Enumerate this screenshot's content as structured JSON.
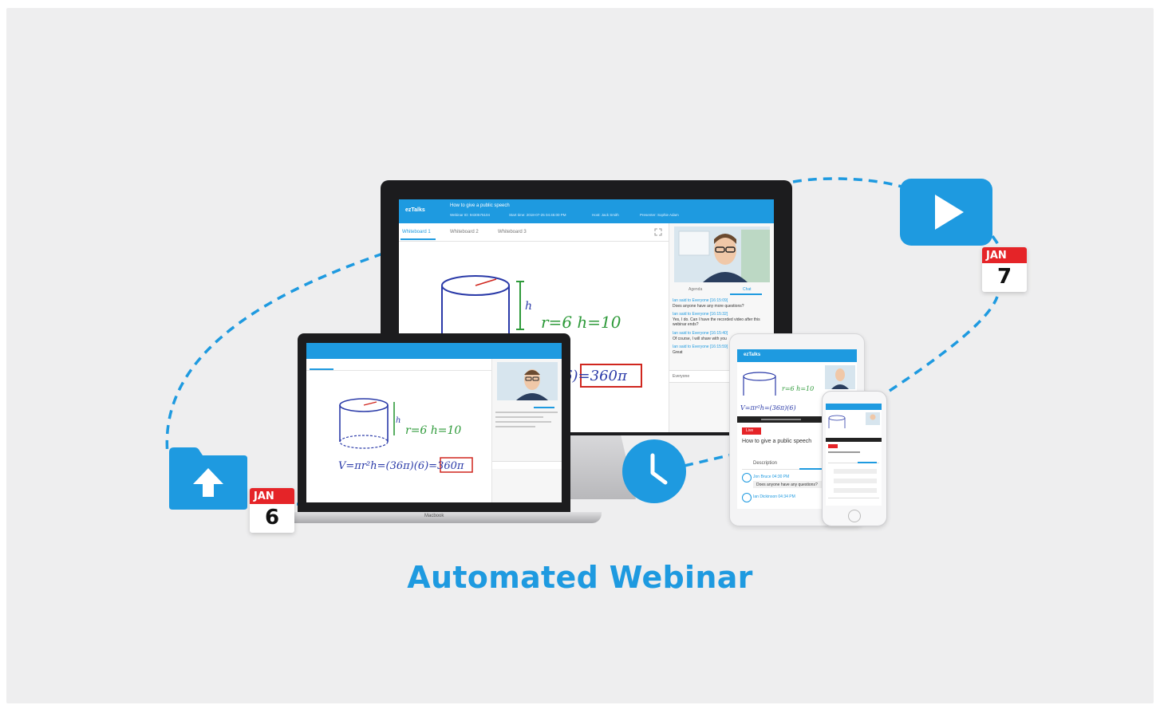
{
  "headline": "Automated Webinar",
  "colors": {
    "accent": "#1e9ae0",
    "calendar_red": "#e52428",
    "background": "#eeeeef"
  },
  "icons": [
    "upload-folder-icon",
    "play-video-icon",
    "clock-icon",
    "calendar-icon"
  ],
  "calendar_left": {
    "month": "JAN",
    "day": "6"
  },
  "calendar_right": {
    "month": "JAN",
    "day": "7"
  },
  "monitor": {
    "brand": "ezTalks",
    "title": "How to give a public speech",
    "meta": [
      "Webinar ID: 9430575104",
      "Start time: 2018-07-25 04:45:00 PM",
      "Host: Jack Smith",
      "Presenter: Sophie Adam"
    ],
    "tabs": [
      "Whiteboard 1",
      "Whiteboard 2",
      "Whiteboard 3"
    ],
    "side_tabs": [
      "Agenda",
      "Chat"
    ],
    "chat": [
      "Ian said to Everyone [16:15:09]",
      "Does anyone have any more questions?",
      "Ian said to Everyone [16:15:32]",
      "Yes, I do. Can I have the recorded video after this webinar ends?",
      "Ian said to Everyone [16:15:40]",
      "Of course, I will share with you",
      "Ian said to Everyone [16:15:59]",
      "Great"
    ],
    "chat_input": "Everyone",
    "formula_1": "r=6  h=10",
    "formula_2": "/6)=360π"
  },
  "laptop": {
    "label": "Macbook",
    "formula_1": "r=6  h=10",
    "formula_2": "V=πr²h=(36π)(6)=360π"
  },
  "tablet": {
    "brand": "ezTalks",
    "live": "Live",
    "title": "How to give a public speech",
    "tab": "Description",
    "rows": [
      "Jon Bruce  04:30 PM",
      "Does anyone have any questions?",
      "Ian Dickinson  04:34 PM"
    ]
  }
}
